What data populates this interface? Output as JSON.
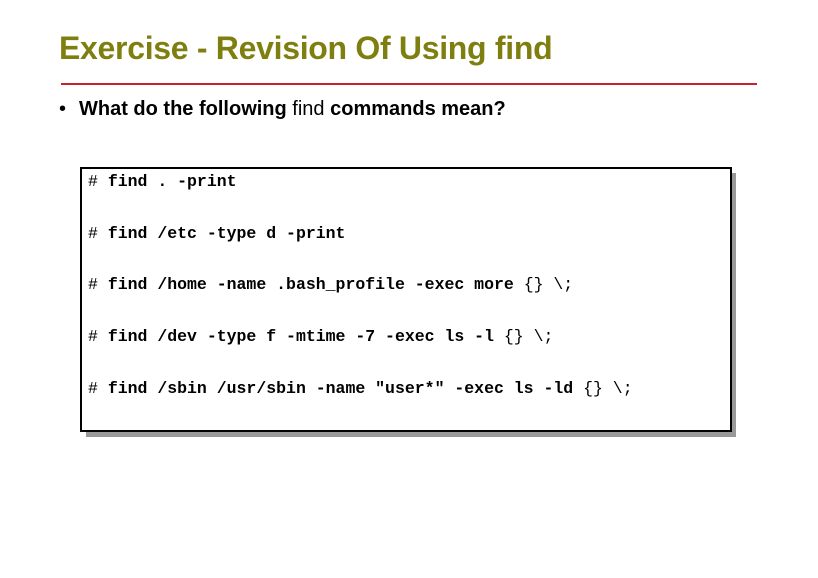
{
  "title": "Exercise - Revision Of Using find",
  "accent_colors": {
    "title": "#7f7f10",
    "rule": "#cc1f2f"
  },
  "bullet": {
    "symbol": "•",
    "part1": "What do the following ",
    "part2": "find",
    "part3": " commands mean?"
  },
  "commands": [
    {
      "prompt": "# ",
      "bold": "find . -print",
      "tail": ""
    },
    {
      "prompt": "# ",
      "bold": "find /etc -type d -print",
      "tail": ""
    },
    {
      "prompt": "# ",
      "bold": "find /home -name .bash_profile -exec more ",
      "tail": "{} \\;"
    },
    {
      "prompt": "# ",
      "bold": "find /dev -type f -mtime -7 -exec ls -l ",
      "tail": "{} \\;"
    },
    {
      "prompt": "# ",
      "bold": "find /sbin /usr/sbin -name \"user*\" -exec ls -ld ",
      "tail": "{} \\;"
    }
  ]
}
